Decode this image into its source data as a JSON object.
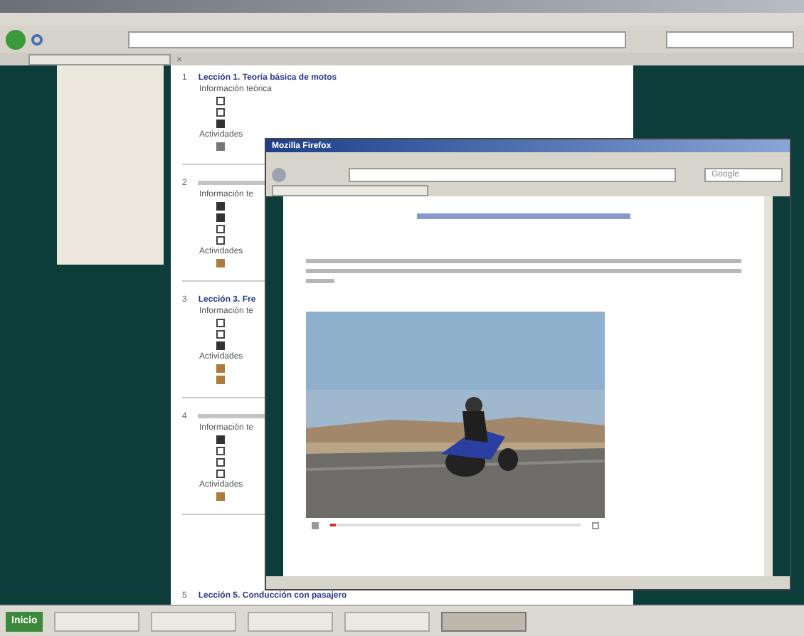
{
  "browser": {
    "tab_close": "×"
  },
  "lessons": [
    {
      "number": "1",
      "title": "Lección 1. Teoría básica de motos",
      "theory_label": "Información teórica",
      "items": [
        {
          "kind": "page"
        },
        {
          "kind": "page"
        },
        {
          "kind": "file"
        }
      ],
      "activities_label": "Actividades",
      "activities": [
        {
          "kind": "quiz"
        }
      ]
    },
    {
      "number": "2",
      "theory_label": "Información te",
      "items": [
        {
          "kind": "file"
        },
        {
          "kind": "file"
        },
        {
          "kind": "page"
        },
        {
          "kind": "page"
        }
      ],
      "activities_label": "Actividades",
      "activities": [
        {
          "kind": "task"
        }
      ]
    },
    {
      "number": "3",
      "title": "Lección 3. Fre",
      "theory_label": "Información te",
      "items": [
        {
          "kind": "page"
        },
        {
          "kind": "page"
        },
        {
          "kind": "file"
        }
      ],
      "activities_label": "Actividades",
      "activities": [
        {
          "kind": "task"
        },
        {
          "kind": "task"
        }
      ]
    },
    {
      "number": "4",
      "theory_label": "Información te",
      "items": [
        {
          "kind": "file"
        },
        {
          "kind": "page"
        },
        {
          "kind": "page"
        },
        {
          "kind": "page"
        }
      ],
      "activities_label": "Actividades",
      "activities": [
        {
          "kind": "task"
        }
      ]
    }
  ],
  "last_lesson": {
    "number": "5",
    "title": "Lección 5. Conducción con pasajero"
  },
  "popup": {
    "title": "Mozilla Firefox",
    "search_placeholder": "Google",
    "video": {
      "kind": "picture",
      "level": 0.02
    }
  },
  "taskbar": {
    "start": "Inicio",
    "buttons": [
      {
        "selected": false
      },
      {
        "selected": false
      },
      {
        "selected": false
      },
      {
        "selected": false
      },
      {
        "selected": true
      }
    ]
  }
}
